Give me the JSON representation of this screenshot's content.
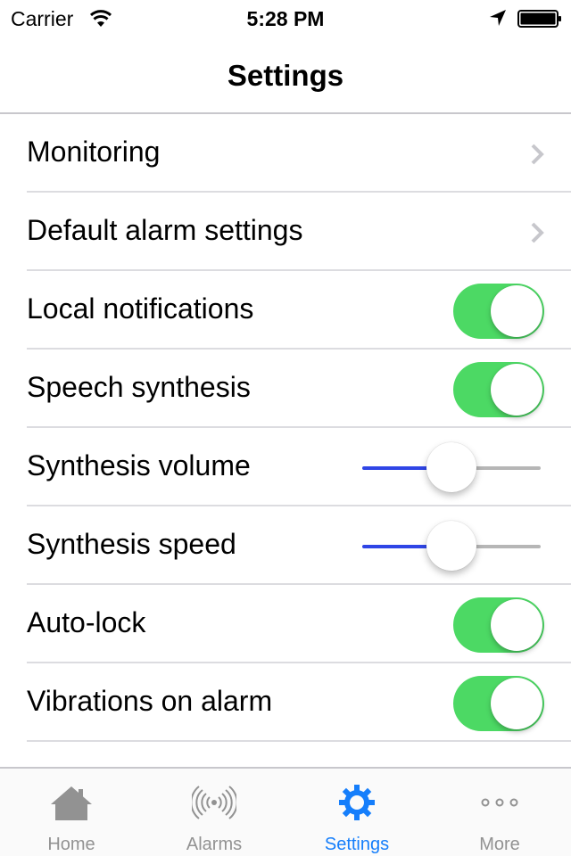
{
  "status_bar": {
    "carrier": "Carrier",
    "time": "5:28 PM",
    "wifi_icon": "wifi-icon",
    "location_icon": "location-arrow-icon",
    "battery_icon": "battery-icon"
  },
  "nav": {
    "title": "Settings"
  },
  "settings": [
    {
      "label": "Monitoring",
      "type": "disclosure"
    },
    {
      "label": "Default alarm settings",
      "type": "disclosure"
    },
    {
      "label": "Local notifications",
      "type": "switch",
      "on": true
    },
    {
      "label": "Speech synthesis",
      "type": "switch",
      "on": true
    },
    {
      "label": "Synthesis volume",
      "type": "slider",
      "value_percent": 50
    },
    {
      "label": "Synthesis speed",
      "type": "slider",
      "value_percent": 50
    },
    {
      "label": "Auto-lock",
      "type": "switch",
      "on": true
    },
    {
      "label": "Vibrations on alarm",
      "type": "switch",
      "on": true
    }
  ],
  "tabs": [
    {
      "label": "Home",
      "icon": "home-icon",
      "active": false
    },
    {
      "label": "Alarms",
      "icon": "alarm-signal-icon",
      "active": false
    },
    {
      "label": "Settings",
      "icon": "gear-icon",
      "active": true
    },
    {
      "label": "More",
      "icon": "more-icon",
      "active": false
    }
  ],
  "colors": {
    "switch_on": "#4cd964",
    "slider_min": "#2f45e6",
    "tint": "#157efb",
    "inactive_tab": "#929292"
  }
}
